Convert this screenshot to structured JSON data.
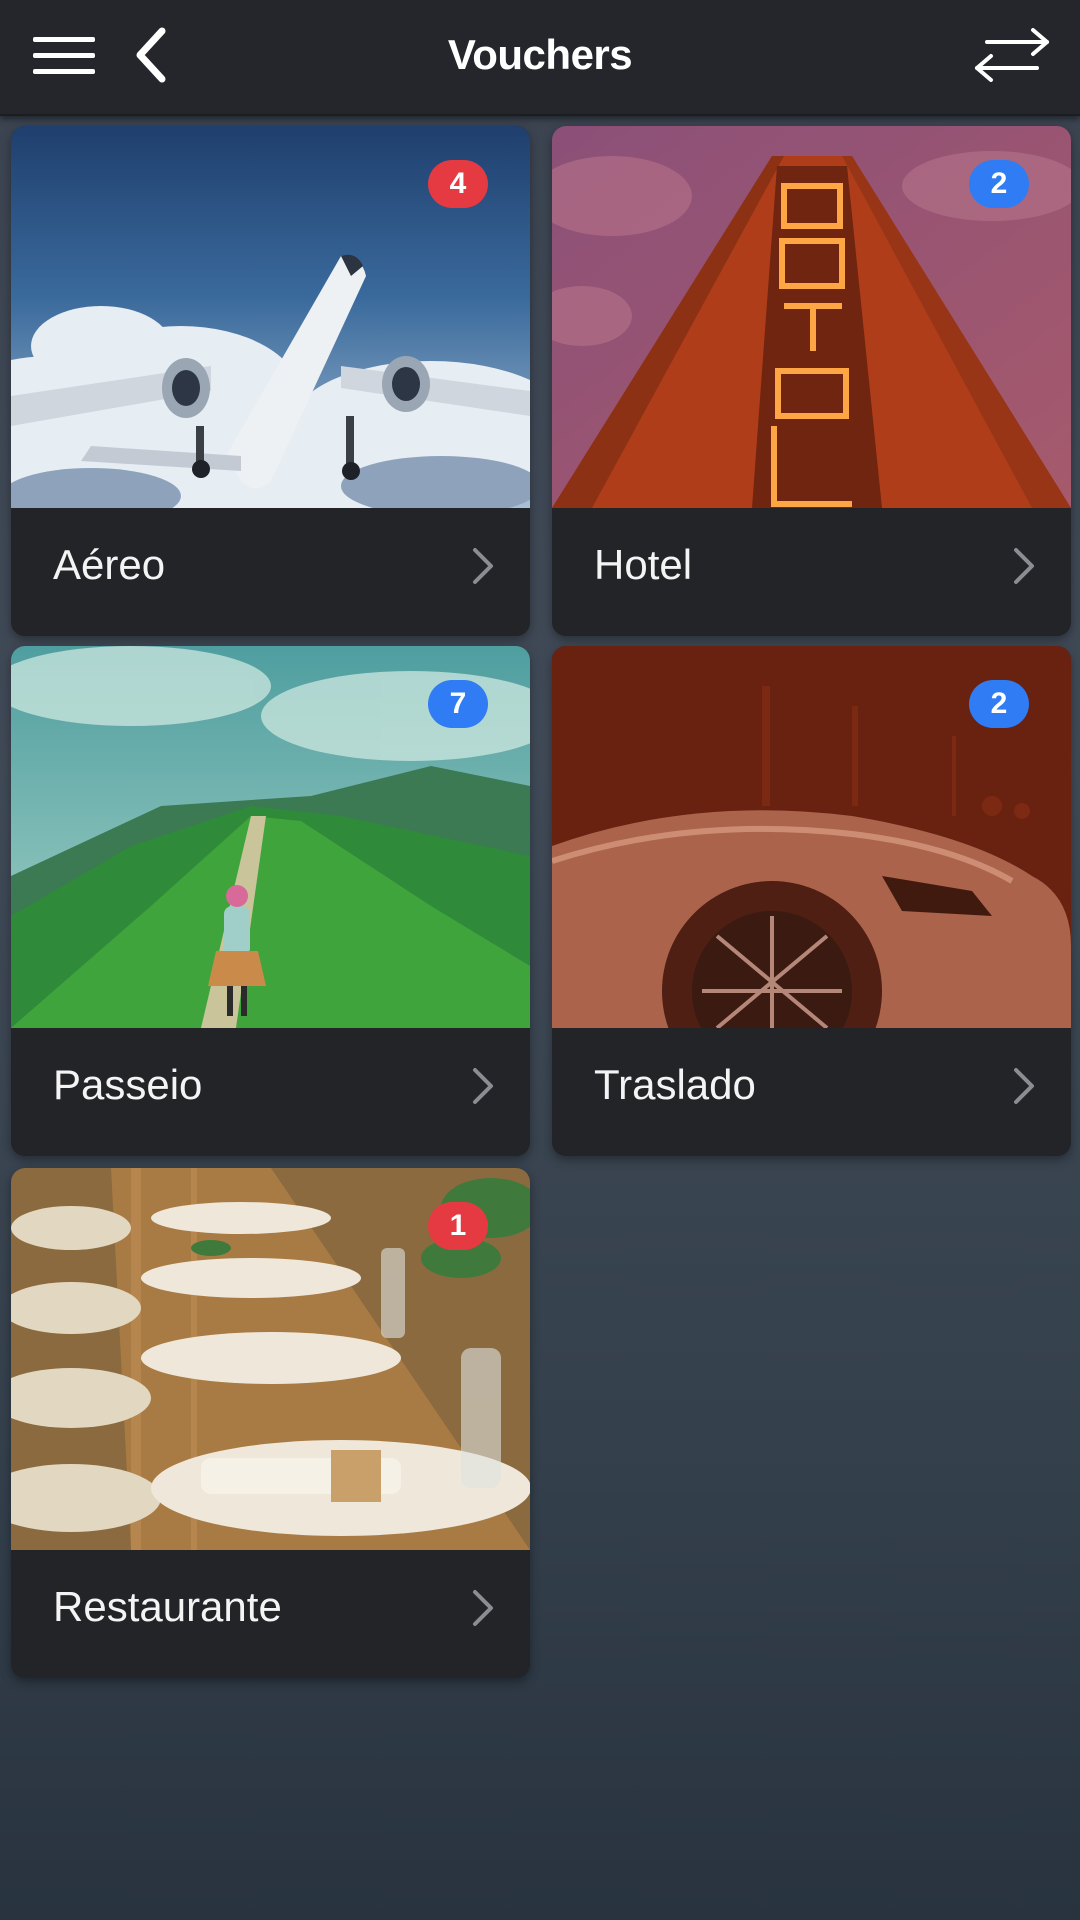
{
  "header": {
    "title": "Vouchers",
    "icons": {
      "menu": "hamburger-menu-icon",
      "back": "chevron-left-icon",
      "swap": "swap-arrows-icon"
    }
  },
  "colors": {
    "appbar": "#24262b",
    "card_label_bg": "#232428",
    "badge_red": "#e53a42",
    "badge_blue": "#2f7cf4"
  },
  "categories": [
    {
      "label": "Aéreo",
      "badge": "4",
      "badge_color": "red",
      "image": "airplane-in-clouds"
    },
    {
      "label": "Hotel",
      "badge": "2",
      "badge_color": "blue",
      "image": "neon-hotel-sign"
    },
    {
      "label": "Passeio",
      "badge": "7",
      "badge_color": "blue",
      "image": "hiker-on-green-ridge"
    },
    {
      "label": "Traslado",
      "badge": "2",
      "badge_color": "blue",
      "image": "car-front"
    },
    {
      "label": "Restaurante",
      "badge": "1",
      "badge_color": "red",
      "image": "dining-table-setting"
    }
  ]
}
